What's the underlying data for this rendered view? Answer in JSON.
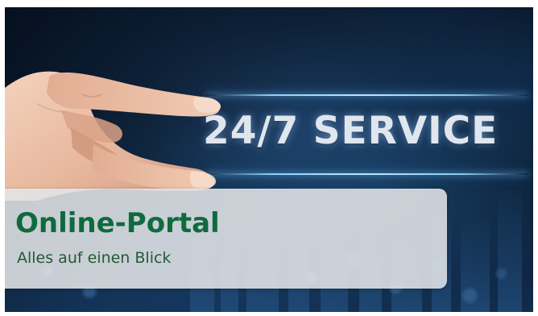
{
  "banner": {
    "headline": "24/7 SERVICE",
    "panel": {
      "title": "Online-Portal",
      "subtitle": "Alles auf einen Blick"
    },
    "colors": {
      "background": "#071324",
      "headline_text": "#dfe6ee",
      "glow_line": "#9fd6ff",
      "panel_background": "#e2e5e7",
      "title_green": "#0f6a3e",
      "subtitle_green": "#245a35"
    },
    "image": {
      "subject": "hand-pinching-icon"
    }
  }
}
